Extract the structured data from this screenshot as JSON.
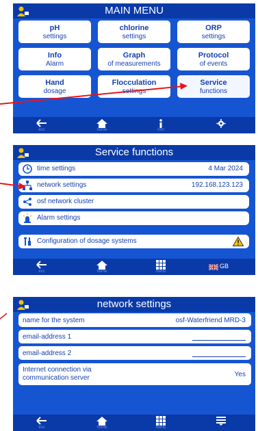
{
  "main_menu": {
    "title": "MAIN MENU",
    "tiles": [
      {
        "l1": "pH",
        "l2": "settings"
      },
      {
        "l1": "chlorine",
        "l2": "settings"
      },
      {
        "l1": "ORP",
        "l2": "settings"
      },
      {
        "l1": "Info",
        "l2": "Alarm"
      },
      {
        "l1": "Graph",
        "l2": "of measurements"
      },
      {
        "l1": "Protocol",
        "l2": "of events"
      },
      {
        "l1": "Hand",
        "l2": "dosage"
      },
      {
        "l1": "Flocculation",
        "l2": "settings"
      },
      {
        "l1": "Service",
        "l2": "functions"
      }
    ],
    "nav": {
      "esc": "esc",
      "home": "home",
      "info": "info"
    }
  },
  "service": {
    "title": "Service functions",
    "rows": [
      {
        "label": "time settings",
        "value": "4 Mar 2024"
      },
      {
        "label": "network settings",
        "value": "192.168.123.123"
      },
      {
        "label": "osf network cluster",
        "value": ""
      },
      {
        "label": "Alarm settings",
        "value": ""
      },
      {
        "label": "Configuration of dosage systems",
        "value": ""
      }
    ],
    "nav": {
      "esc": "esc",
      "home": "home",
      "menu": "menu",
      "lang": "GB"
    }
  },
  "network": {
    "title": "network settings",
    "rows": [
      {
        "label": "name for the system",
        "value": "osf-Waterfriend MRD-3"
      },
      {
        "label": "email-address 1",
        "value": ""
      },
      {
        "label": "email-address 2",
        "value": ""
      },
      {
        "label": "Internet connection via\ncommunication server",
        "value": "Yes"
      }
    ],
    "nav": {
      "esc": "esc",
      "home": "home",
      "menu": "menu"
    }
  },
  "colors": {
    "screen_bg": "#1655d2",
    "bar": "#0a3aa8",
    "text": "#1540b0",
    "arrow": "#e8141a"
  }
}
